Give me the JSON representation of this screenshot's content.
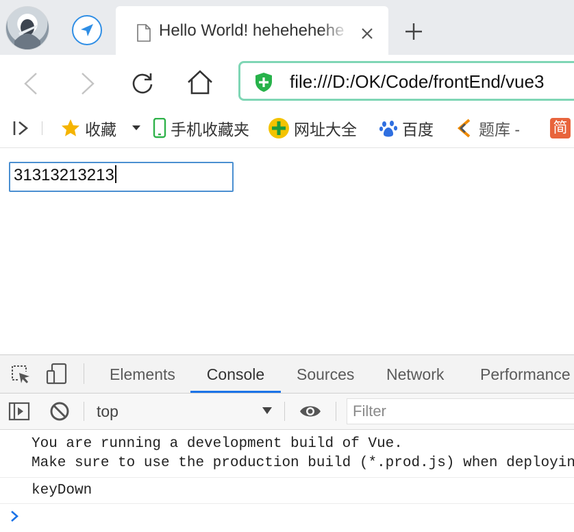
{
  "browser": {
    "tab": {
      "title": "Hello World! hehehehehe"
    },
    "address": {
      "url": "file:///D:/OK/Code/frontEnd/vue3"
    }
  },
  "bookmarks": {
    "items": [
      {
        "label": "收藏"
      },
      {
        "label": "手机收藏夹"
      },
      {
        "label": "网址大全"
      },
      {
        "label": "百度"
      },
      {
        "label": "题库 -"
      },
      {
        "label": "简"
      }
    ]
  },
  "page": {
    "input_value": "31313213213"
  },
  "devtools": {
    "tabs": [
      "Elements",
      "Console",
      "Sources",
      "Network",
      "Performance"
    ],
    "active_tab": "Console",
    "context": "top",
    "filter_placeholder": "Filter",
    "messages": [
      "You are running a development build of Vue.\nMake sure to use the production build (*.prod.js) when deploying for production.",
      "keyDown"
    ]
  },
  "colors": {
    "address_border": "#7fd6b5",
    "secure_shield": "#27b24a",
    "active_tab_underline": "#1a73e8",
    "input_border": "#4a8fd1"
  },
  "icons": [
    "avatar",
    "navigation-arrow-icon",
    "document-icon",
    "close-icon",
    "plus-icon",
    "back-icon",
    "forward-icon",
    "reload-icon",
    "home-icon",
    "shield-icon",
    "sidebar-toggle-icon",
    "star-icon",
    "chevron-down-icon",
    "mobile-icon",
    "sites-icon",
    "baidu-paw-icon",
    "tiku-icon",
    "inspect-icon",
    "device-icon",
    "sidebar-icon",
    "clear-icon",
    "dropdown-arrow-icon",
    "eye-icon",
    "prompt-chevron-icon"
  ]
}
